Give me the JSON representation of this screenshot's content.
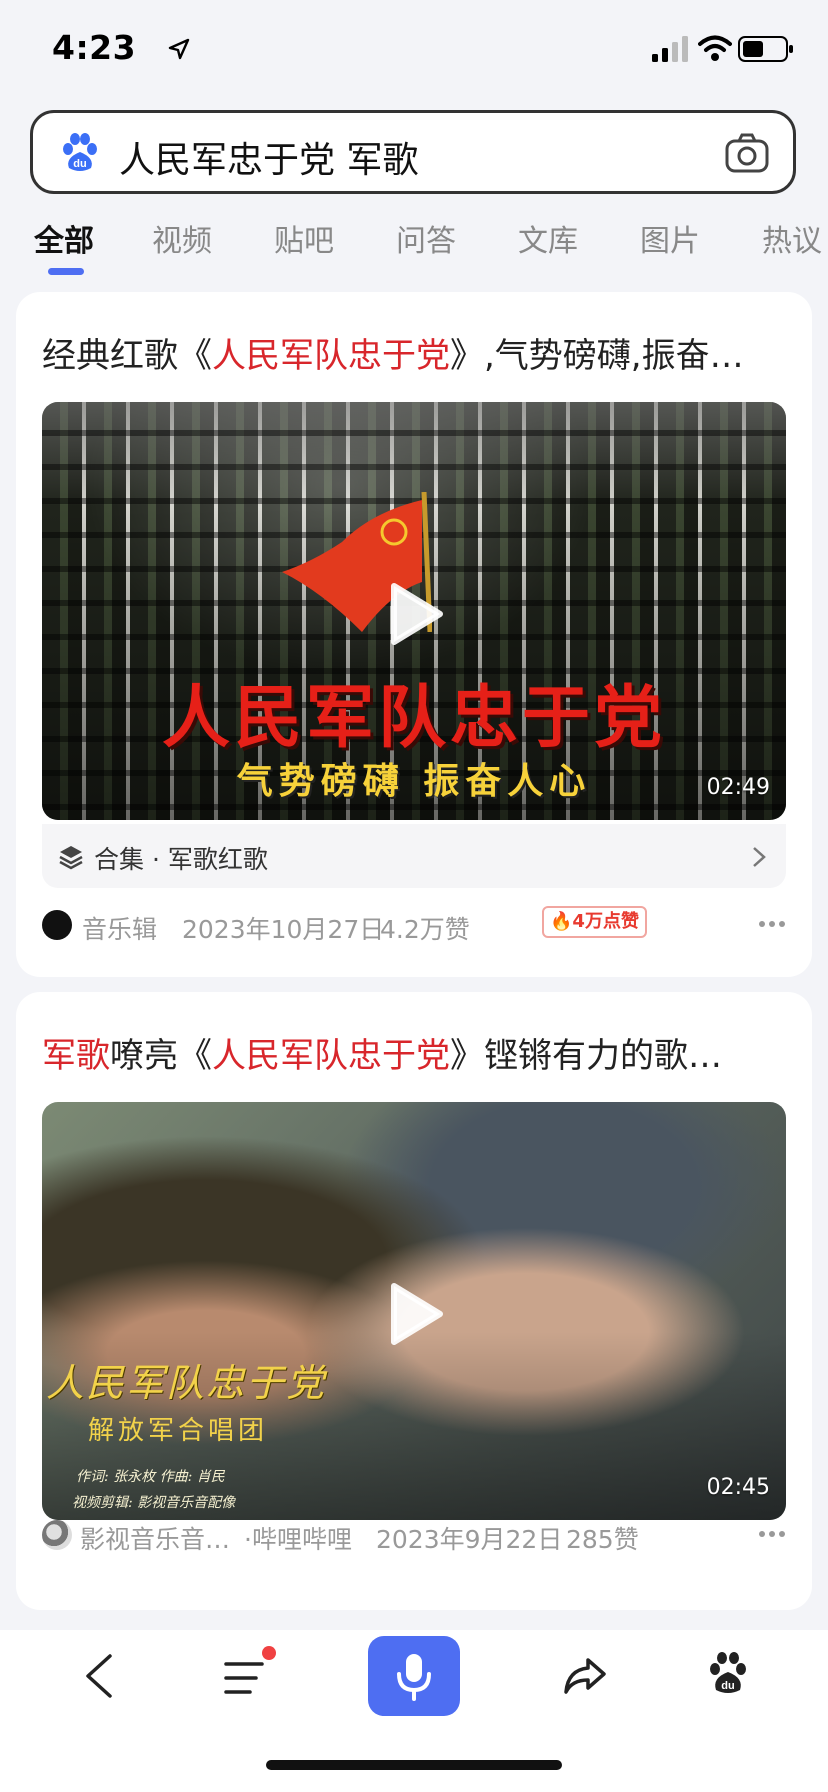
{
  "status_bar": {
    "time": "4:23"
  },
  "search": {
    "query": "人民军忠于党 军歌"
  },
  "tabs": [
    {
      "label": "全部"
    },
    {
      "label": "视频"
    },
    {
      "label": "贴吧"
    },
    {
      "label": "问答"
    },
    {
      "label": "文库"
    },
    {
      "label": "图片"
    },
    {
      "label": "热议"
    }
  ],
  "results": [
    {
      "title_pre": "经典红歌《",
      "title_hl": "人民军队忠于党",
      "title_post": "》,气势磅礴,振奋…",
      "overlay_big": "人民军队忠于党",
      "overlay_small": "气势磅礴  振奋人心",
      "duration": "02:49",
      "collection": "合集 · 军歌红歌",
      "source": "音乐辑",
      "date": "2023年10月27日",
      "likes": "4.2万赞",
      "hot_badge": "4万点赞"
    },
    {
      "title_hl1": "军歌",
      "title_mid": "嘹亮《",
      "title_hl": "人民军队忠于党",
      "title_post": "》铿锵有力的歌…",
      "overlay_title": "人民军队忠于党",
      "overlay_sub": "解放军合唱团",
      "overlay_credit1": "作词: 张永枚    作曲: 肖民",
      "overlay_credit2": "视频剪辑: 影视音乐音配像",
      "duration": "02:45",
      "source": "影视音乐音…",
      "platform": "·哔哩哔哩",
      "date": "2023年9月22日",
      "likes": "285赞"
    }
  ],
  "colors": {
    "accent": "#4e6ef2",
    "highlight": "#d8262b",
    "hot": "#e83a2f"
  },
  "icons": [
    "location-arrow-icon",
    "signal-icon",
    "wifi-icon",
    "battery-icon",
    "baidu-paw-icon",
    "camera-icon",
    "play-icon",
    "stack-icon",
    "chevron-right-icon",
    "more-icon",
    "back-icon",
    "menu-icon",
    "mic-icon",
    "share-icon",
    "baidu-home-icon"
  ]
}
